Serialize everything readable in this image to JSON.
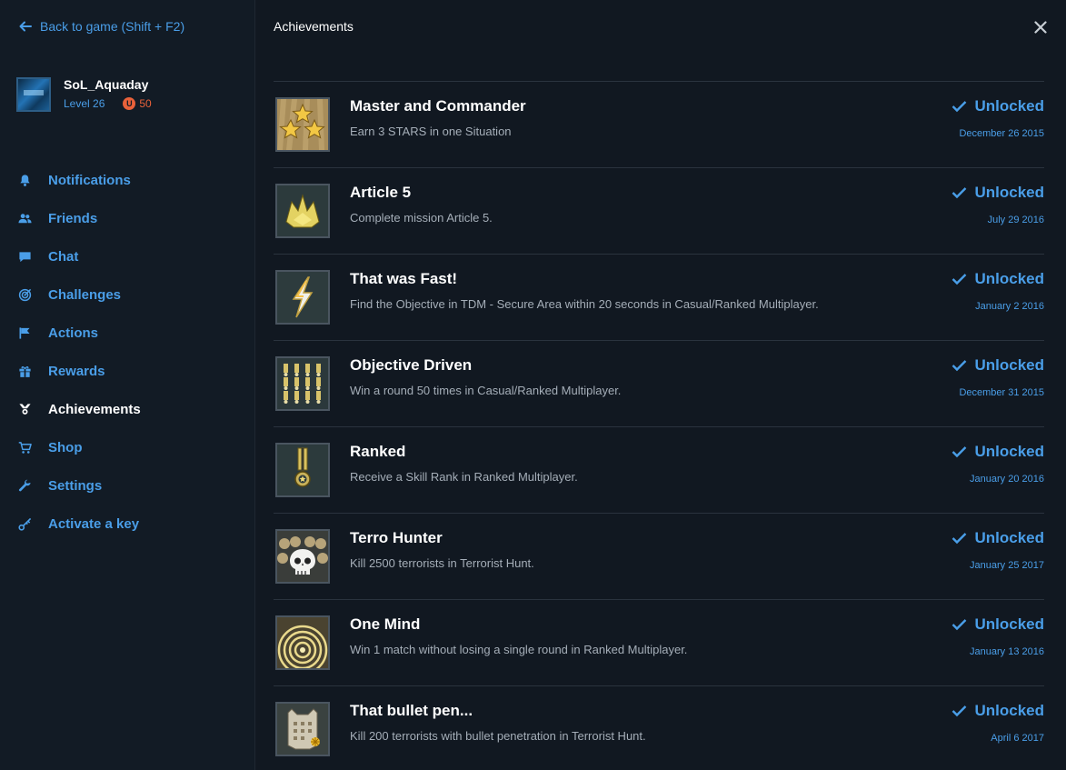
{
  "sidebar": {
    "back_label": "Back to game (Shift + F2)",
    "profile": {
      "username": "SoL_Aquaday",
      "level": "Level 26",
      "credits": "50"
    },
    "nav": [
      {
        "label": "Notifications",
        "icon": "bell-icon"
      },
      {
        "label": "Friends",
        "icon": "friends-icon"
      },
      {
        "label": "Chat",
        "icon": "chat-icon"
      },
      {
        "label": "Challenges",
        "icon": "target-icon"
      },
      {
        "label": "Actions",
        "icon": "flag-icon"
      },
      {
        "label": "Rewards",
        "icon": "gift-icon"
      },
      {
        "label": "Achievements",
        "icon": "trophy-icon",
        "active": true
      },
      {
        "label": "Shop",
        "icon": "cart-icon"
      },
      {
        "label": "Settings",
        "icon": "wrench-icon"
      },
      {
        "label": "Activate a key",
        "icon": "key-icon"
      }
    ]
  },
  "main": {
    "title": "Achievements",
    "achievements": [
      {
        "title": "Master and Commander",
        "description": "Earn 3 STARS in one Situation",
        "status": "Unlocked",
        "date": "December 26 2015",
        "icon": "stars-badge-icon"
      },
      {
        "title": "Article 5",
        "description": "Complete mission Article 5.",
        "status": "Unlocked",
        "date": "July 29 2016",
        "icon": "crown-badge-icon"
      },
      {
        "title": "That was Fast!",
        "description": "Find the Objective in TDM - Secure Area within 20 seconds in Casual/Ranked Multiplayer.",
        "status": "Unlocked",
        "date": "January 2 2016",
        "icon": "lightning-badge-icon"
      },
      {
        "title": "Objective Driven",
        "description": "Win a round 50 times in Casual/Ranked Multiplayer.",
        "status": "Unlocked",
        "date": "December 31 2015",
        "icon": "medals-badge-icon"
      },
      {
        "title": "Ranked",
        "description": "Receive a Skill Rank in Ranked Multiplayer.",
        "status": "Unlocked",
        "date": "January 20 2016",
        "icon": "medal-badge-icon"
      },
      {
        "title": "Terro Hunter",
        "description": "Kill 2500 terrorists in Terrorist Hunt.",
        "status": "Unlocked",
        "date": "January 25 2017",
        "icon": "skulls-badge-icon"
      },
      {
        "title": "One Mind",
        "description": "Win 1 match without losing a single round in Ranked Multiplayer.",
        "status": "Unlocked",
        "date": "January 13 2016",
        "icon": "rings-badge-icon"
      },
      {
        "title": "That bullet pen...",
        "description": "Kill 200 terrorists with bullet penetration in Terrorist Hunt.",
        "status": "Unlocked",
        "date": "April 6 2017",
        "icon": "vest-badge-icon"
      }
    ]
  },
  "colors": {
    "accent": "#4a9ee8",
    "background": "#111821",
    "sidebar": "#121b25",
    "credits": "#e8613a",
    "description": "#a5aeb8"
  }
}
